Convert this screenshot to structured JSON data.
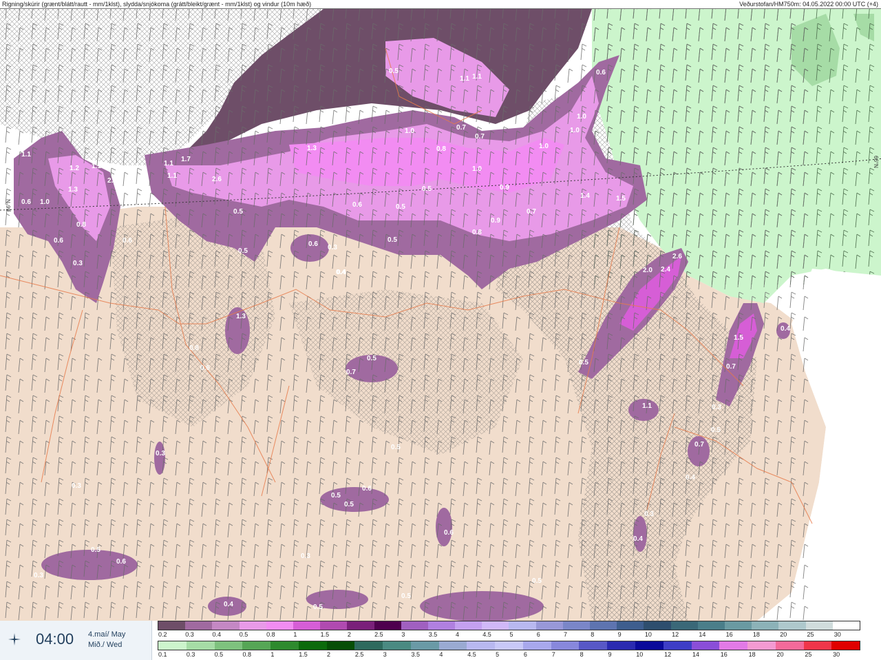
{
  "header": {
    "left_title": "Rigning/skúrir (grænt/blátt/rautt - mm/1klst), slydda/snjókoma (grátt/bleikt/grænt - mm/1klst) og vindur (10m hæð)",
    "right_title": "Veðurstofan/HM750m: 04.05.2022 00:00 UTC (+4)"
  },
  "timebox": {
    "time": "04:00",
    "date_line1": "4.maí/ May",
    "date_line2": "Mið./ Wed",
    "logo_icon": "vedurstofan-logo-icon"
  },
  "map_labels": {
    "lat_left": "66°N",
    "lat_right": "66°N",
    "precip_values": [
      "0.5",
      "1.1",
      "1.1",
      "0.6",
      "1.0",
      "0.7",
      "0.7",
      "0.8",
      "1.0",
      "1.0",
      "1.0",
      "1.3",
      "1.1",
      "1.7",
      "1.1",
      "2.6",
      "1.0",
      "0.9",
      "0.5",
      "1.4",
      "1.5",
      "0.8",
      "0.9",
      "0.6",
      "0.5",
      "0.5",
      "0.7",
      "0.5",
      "0.4",
      "0.3",
      "0.6",
      "1.2",
      "1.1",
      "1.3",
      "2.1",
      "0.8",
      "0.6",
      "0.6",
      "0.3",
      "0.6",
      "1.0",
      "1.1",
      "0.4",
      "0.5",
      "2.6",
      "2.0",
      "2.4",
      "1.5",
      "0.7",
      "0.5",
      "0.4",
      "0.3",
      "0.5",
      "0.7",
      "0.5",
      "1.1",
      "0.7",
      "0.4",
      "0.3",
      "0.6",
      "0.5",
      "0.3",
      "0.3",
      "0.4",
      "0.3",
      "0.5",
      "0.6",
      "0.3",
      "0.5",
      "0.5",
      "0.4",
      "0.5",
      "0.5",
      "0.6",
      "1.3",
      "0.8",
      "0.6",
      "0.5"
    ]
  },
  "scale_snow": {
    "labels": [
      "0.2",
      "0.3",
      "0.4",
      "0.5",
      "0.8",
      "1",
      "1.5",
      "2",
      "2.5",
      "3",
      "3.5",
      "4",
      "4.5",
      "5",
      "6",
      "7",
      "8",
      "9",
      "10",
      "12",
      "14",
      "16",
      "18",
      "20",
      "25",
      "30"
    ],
    "colors": [
      "#6e4e68",
      "#a06aa0",
      "#c488c4",
      "#e89ae8",
      "#f28cf2",
      "#d65ed6",
      "#b04ab0",
      "#7a207a",
      "#4e004e",
      "#a060c0",
      "#b080e0",
      "#c4a0f0",
      "#d0b8f8",
      "#b8b8f0",
      "#9898d8",
      "#7a86c8",
      "#5e74b0",
      "#3e5e8e",
      "#2e4e6e",
      "#3a6878",
      "#4a7e8a",
      "#6a9aa2",
      "#8cb2b8",
      "#aec8cc",
      "#d0dcdc",
      "#ffffff"
    ]
  },
  "scale_rain": {
    "labels": [
      "0.1",
      "0.3",
      "0.5",
      "0.8",
      "1",
      "1.5",
      "2",
      "2.5",
      "3",
      "3.5",
      "4",
      "4.5",
      "5",
      "6",
      "7",
      "8",
      "9",
      "10",
      "12",
      "14",
      "16",
      "18",
      "20",
      "25",
      "30"
    ],
    "colors": [
      "#ccf5cc",
      "#a6dca6",
      "#7ec27e",
      "#56a656",
      "#2e8a2e",
      "#0c6a0c",
      "#064e06",
      "#2e6a5e",
      "#4a8a82",
      "#6a9aa6",
      "#9aaad2",
      "#b8b8f0",
      "#c8c8f8",
      "#a8a8ec",
      "#8888dc",
      "#5858c6",
      "#2a2ab0",
      "#0a0a9a",
      "#3e3ec6",
      "#8a4ed8",
      "#e27ae6",
      "#f49ad2",
      "#f46a9a",
      "#f0364a",
      "#e00000"
    ]
  }
}
